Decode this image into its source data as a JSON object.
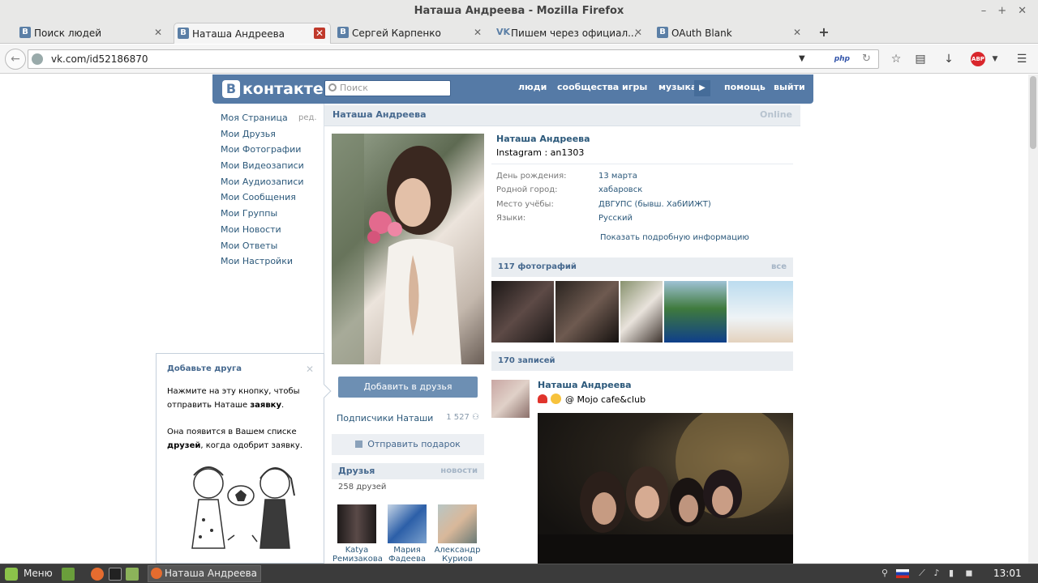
{
  "window": {
    "title": "Наташа Андреева - Mozilla Firefox"
  },
  "tabs": [
    {
      "label": "Поиск людей",
      "favicon": "B"
    },
    {
      "label": "Наташа Андреева",
      "favicon": "B"
    },
    {
      "label": "Сергей Карпенко",
      "favicon": "B"
    },
    {
      "label": "Пишем через официал...",
      "favicon": "VK"
    },
    {
      "label": "OAuth Blank",
      "favicon": "B"
    }
  ],
  "nav": {
    "url": "vk.com/id52186870",
    "php_badge": "php",
    "abp_badge": "ABP"
  },
  "vk": {
    "logo": "контакте",
    "logo_badge": "В",
    "search_placeholder": "Поиск",
    "topnav": [
      "люди",
      "сообщества",
      "игры",
      "музыка",
      "помощь",
      "выйти"
    ],
    "leftmenu": [
      "Моя Страница",
      "Мои Друзья",
      "Мои Фотографии",
      "Мои Видеозаписи",
      "Мои Аудиозаписи",
      "Мои Сообщения",
      "Мои Группы",
      "Мои Новости",
      "Мои Ответы",
      "Мои Настройки"
    ],
    "edit_label": "ред.",
    "profile": {
      "name": "Наташа Андреева",
      "status": "Online",
      "instagram": "Instagram : an1303",
      "info": [
        {
          "label": "День рождения:",
          "value": "13 марта"
        },
        {
          "label": "Родной город:",
          "value": "хабаровск"
        },
        {
          "label": "Место учёбы:",
          "value": "ДВГУПС (бывш. ХабИИЖТ)"
        },
        {
          "label": "Языки:",
          "value": "Русский"
        }
      ],
      "show_more": "Показать подробную информацию",
      "add_friend": "Добавить в друзья",
      "subscribers": "Подписчики Наташи",
      "subscribers_count": "1 527",
      "gift": "Отправить подарок"
    },
    "friends": {
      "title": "Друзья",
      "link": "новости",
      "count": "258 друзей",
      "items": [
        {
          "first": "Katya",
          "last": "Ремизакова"
        },
        {
          "first": "Мария",
          "last": "Фадеева"
        },
        {
          "first": "Александр",
          "last": "Куриов"
        }
      ]
    },
    "photos": {
      "title": "117 фотографий",
      "link": "все"
    },
    "wall": {
      "title": "170 записей",
      "post_author": "Наташа Андреева",
      "post_text": "@ Mojo cafe&club"
    },
    "popup": {
      "title": "Добавьте друга",
      "line1": "Нажмите на эту кнопку, чтобы",
      "line2a": "отправить Наташе ",
      "line2b": "заявку",
      "line2c": ".",
      "line3": "Она появится в Вашем списке",
      "line4a": "друзей",
      "line4b": ", когда одобрит заявку."
    }
  },
  "taskbar": {
    "menu": "Меню",
    "window": "Наташа Андреева ...",
    "clock": "13:01"
  }
}
